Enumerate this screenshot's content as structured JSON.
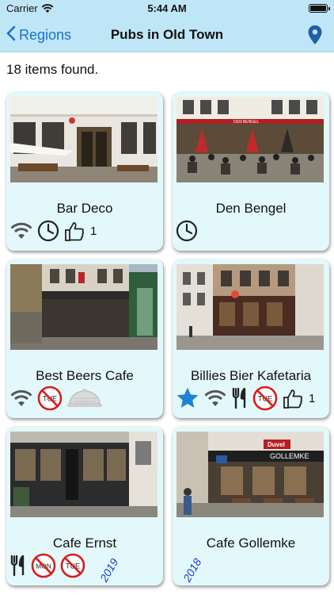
{
  "status_bar": {
    "carrier": "Carrier",
    "time": "5:44 AM"
  },
  "nav": {
    "back_label": "Regions",
    "title": "Pubs in Old Town",
    "back_icon": "chevron-left-icon",
    "right_icon": "location-pin-icon"
  },
  "summary": {
    "items_found": "18 items found."
  },
  "colors": {
    "bar": "#bfe6f7",
    "accent": "#1a6fd1",
    "card": "#e3f8fb",
    "no_sign": "#d81d1d",
    "star": "#1e82d2",
    "year": "#1b3fc4"
  },
  "pubs": [
    {
      "name": "Bar Deco",
      "features": [
        "wifi",
        "clock",
        "thumbs-up"
      ],
      "likes": "1",
      "year": ""
    },
    {
      "name": "Den Bengel",
      "features": [
        "clock"
      ],
      "likes": "",
      "year": ""
    },
    {
      "name": "Best Beers Cafe",
      "features": [
        "wifi",
        "closed-tue",
        "cloche"
      ],
      "likes": "",
      "year": ""
    },
    {
      "name": "Billies Bier Kafetaria",
      "features": [
        "star",
        "wifi",
        "food",
        "closed-tue",
        "thumbs-up"
      ],
      "likes": "1",
      "year": ""
    },
    {
      "name": "Cafe Ernst",
      "features": [
        "food",
        "closed-mon",
        "closed-tue"
      ],
      "likes": "",
      "year": "2019"
    },
    {
      "name": "Cafe Gollemke",
      "features": [],
      "likes": "",
      "year": "2018"
    }
  ],
  "signs": {
    "mon": "MON",
    "tue": "TUE"
  },
  "photo_signs": {
    "duvel": "Duvel",
    "gollemke": "GOLLEMKE",
    "den_bengel": "DEN BENGEL"
  }
}
